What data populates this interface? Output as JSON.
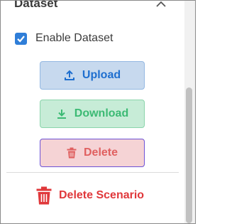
{
  "section": {
    "title": "Dataset",
    "collapse_icon": "chevron-up-icon"
  },
  "enable_dataset": {
    "label": "Enable Dataset",
    "checked": true
  },
  "buttons": {
    "upload": {
      "label": "Upload",
      "icon": "upload-icon"
    },
    "download": {
      "label": "Download",
      "icon": "download-icon"
    },
    "delete": {
      "label": "Delete",
      "icon": "trash-icon"
    }
  },
  "delete_scenario": {
    "label": "Delete Scenario",
    "icon": "trash-icon"
  },
  "colors": {
    "accent_blue": "#1f6fcf",
    "success_green": "#3cba74",
    "danger_red": "#e0383b",
    "checkbox": "#2f7ed8"
  }
}
